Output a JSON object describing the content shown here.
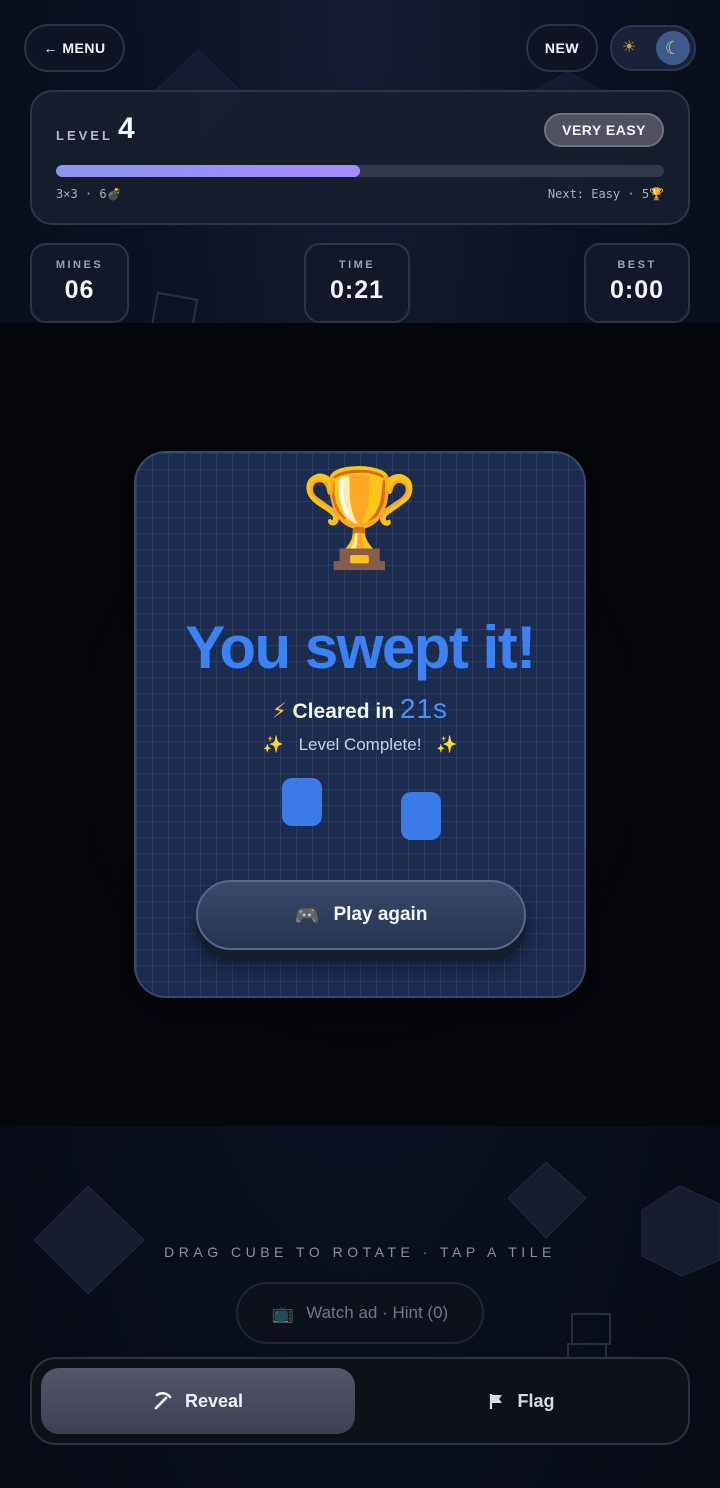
{
  "header": {
    "menu_label": "← MENU",
    "new_label": "NEW",
    "theme_toggle": {
      "sun_icon": "☀",
      "moon_icon": "☾",
      "selected": "dark"
    }
  },
  "level": {
    "label": "LEVEL",
    "number": "4",
    "difficulty": "VERY EASY",
    "progress": 0.5,
    "left_info": "3×3 · 6💣",
    "right_info": "Next: Easy · 5🏆"
  },
  "stats": [
    {
      "label": "MINES",
      "value": "06"
    },
    {
      "label": "TIME",
      "value": "0:21"
    },
    {
      "label": "BEST",
      "value": "0:00"
    }
  ],
  "modal": {
    "trophy_icon": "🏆",
    "title": "You swept it!",
    "cleared_prefix": "Cleared in",
    "cleared_time": "21s",
    "bolt_icon": "⚡",
    "complete_text": "Level Complete!",
    "sparkle_icon": "✨",
    "play_again_icon": "🎮",
    "play_again_label": "Play again"
  },
  "footer": {
    "hint_text": "DRAG CUBE TO ROTATE · TAP A TILE",
    "ad_icon": "📺",
    "ad_label": "Watch ad · Hint (0)",
    "modes": [
      {
        "label": "Reveal",
        "icon": "pickaxe-icon",
        "active": true
      },
      {
        "label": "Flag",
        "icon": "flag-icon",
        "active": false
      }
    ]
  },
  "colors": {
    "accent_blue": "#3b82f6",
    "progress_start": "#8b93f2",
    "progress_end": "#a78bfa"
  }
}
